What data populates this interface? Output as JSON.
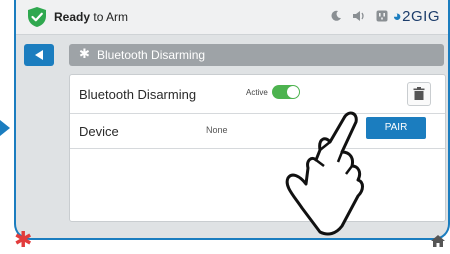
{
  "status": {
    "bold": "Ready",
    "rest": " to Arm",
    "brand_prefix": "◕",
    "brand_text": "2GIG"
  },
  "page": {
    "title": "Bluetooth Disarming"
  },
  "settings": {
    "bt_label": "Bluetooth Disarming",
    "active_label": "Active",
    "toggle_on": true,
    "device_label": "Device",
    "device_value": "None",
    "pair_label": "PAIR"
  },
  "colors": {
    "accent": "#1b7dbf",
    "toggle_on": "#4db34f",
    "shield": "#2fa84f",
    "alert": "#e23c3c"
  }
}
